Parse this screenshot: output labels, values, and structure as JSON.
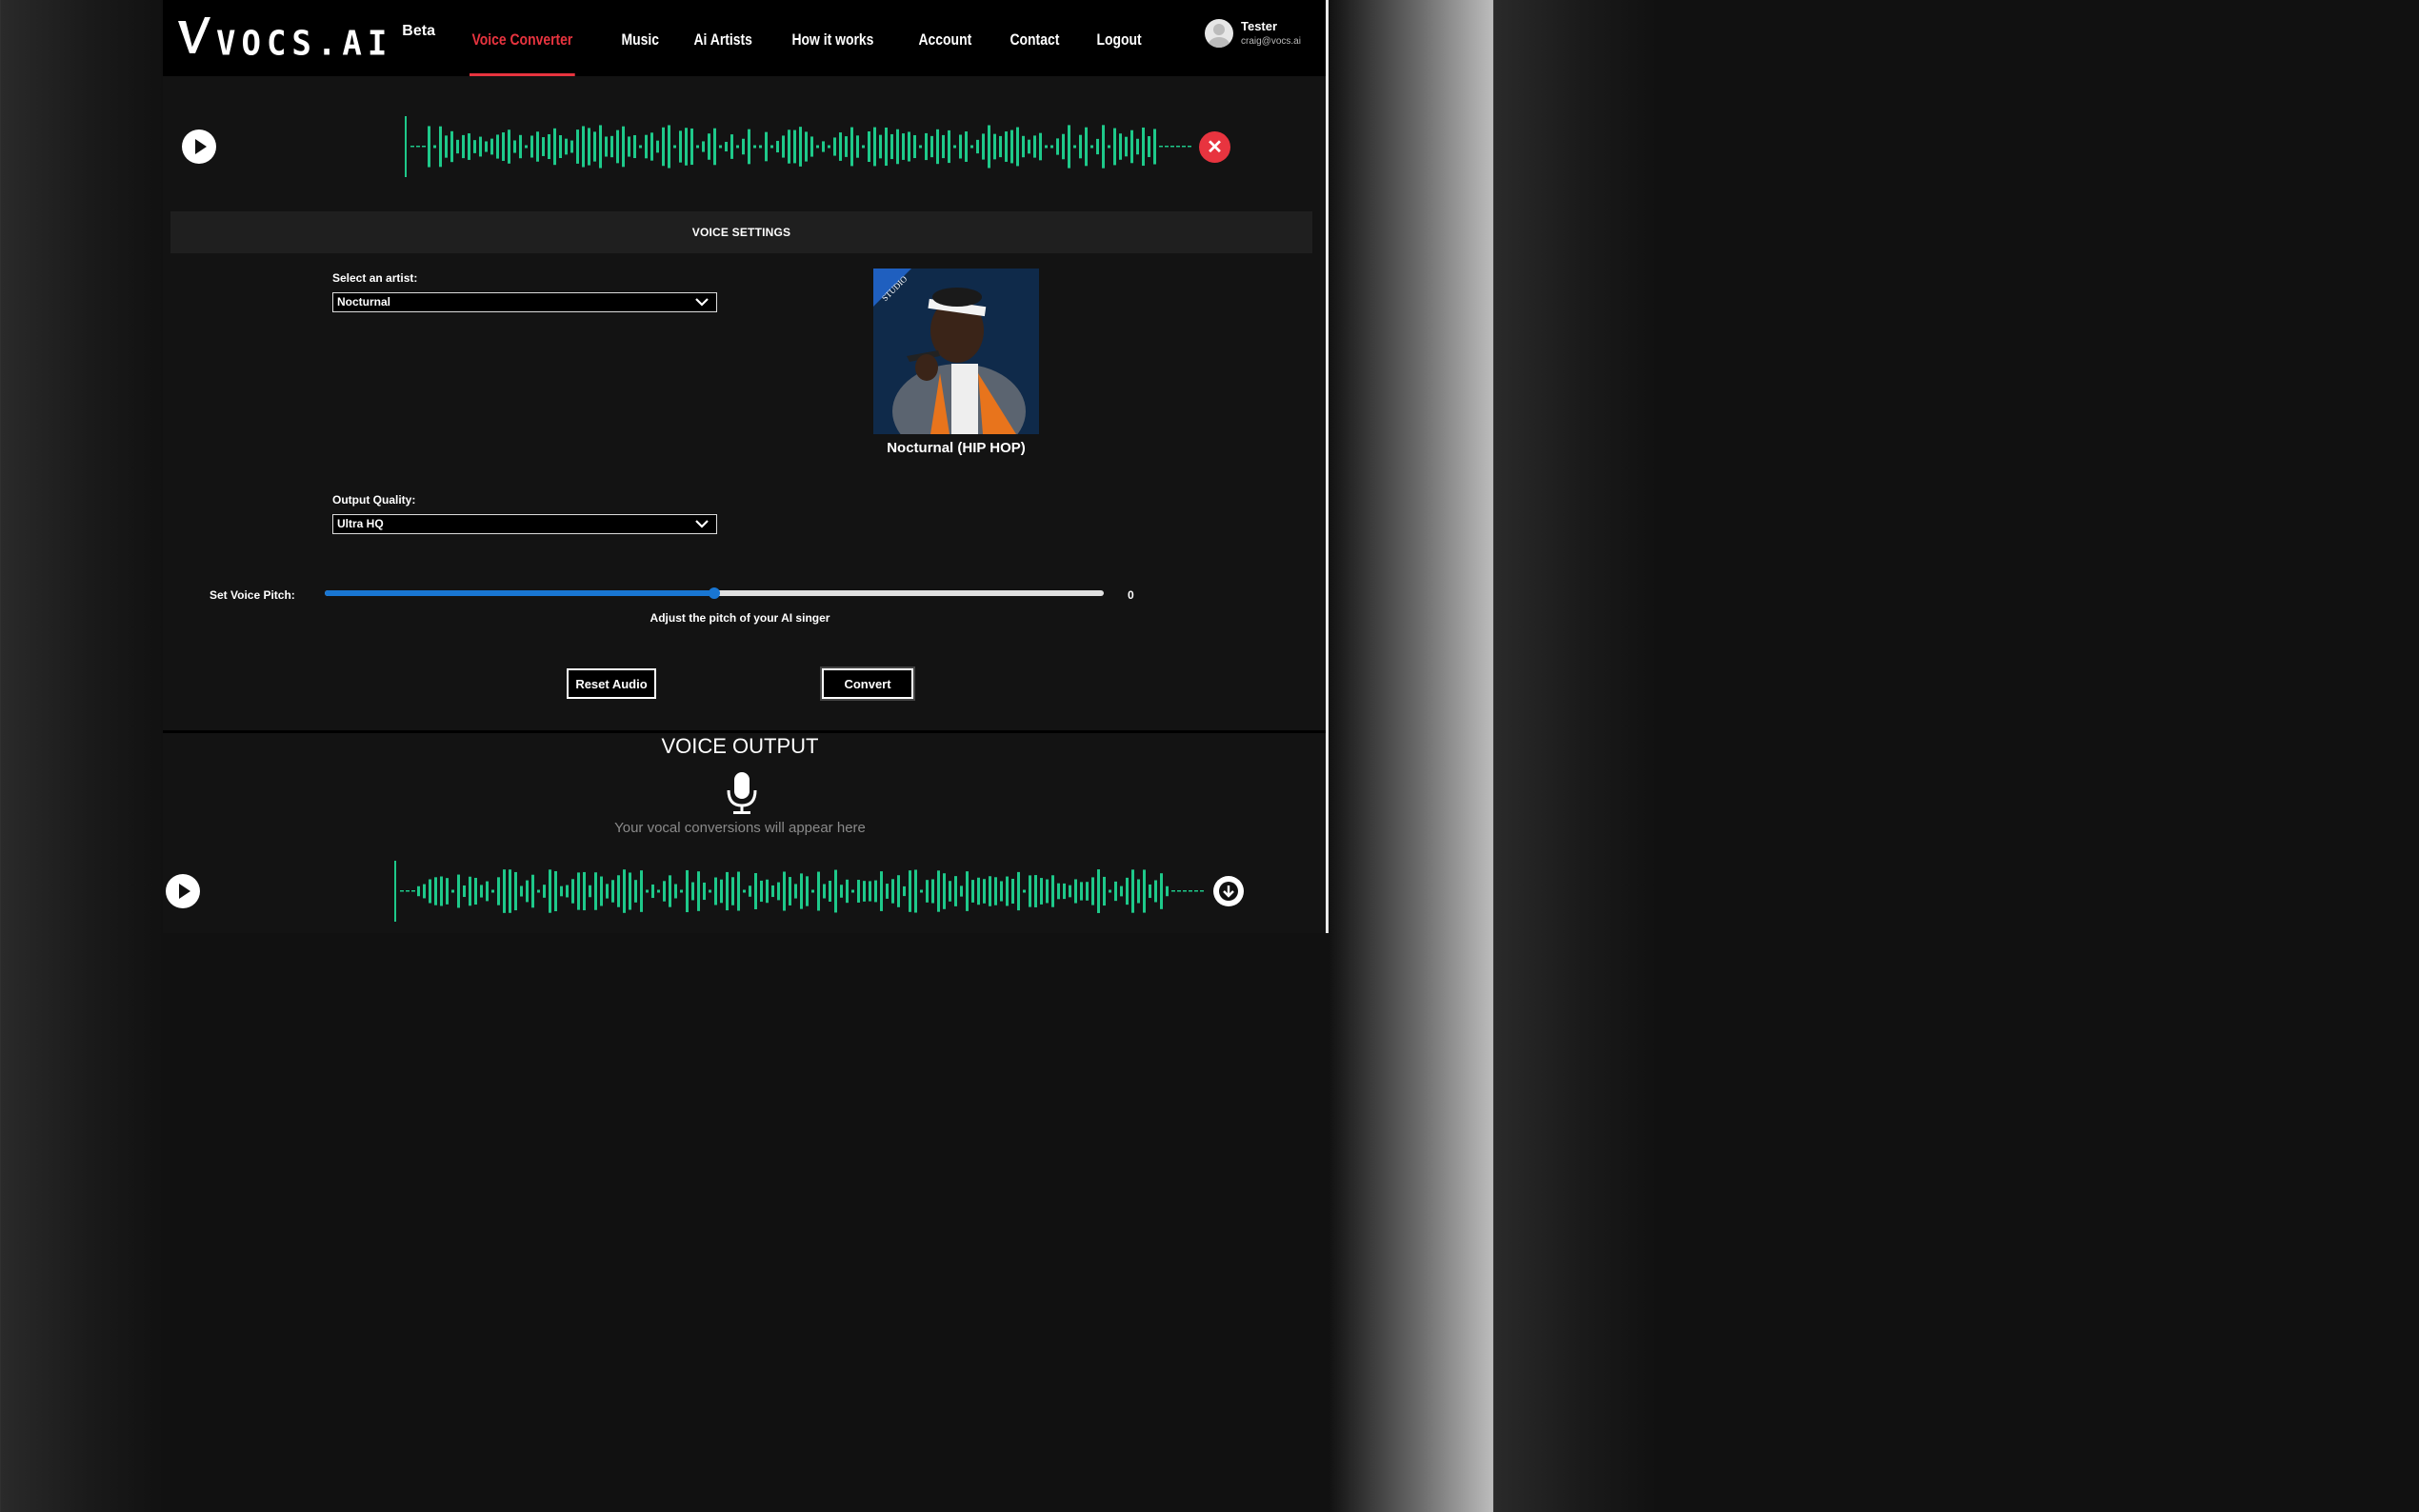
{
  "brand": {
    "name": "VOCS.AI",
    "badge": "Beta"
  },
  "nav": {
    "items": [
      {
        "label": "Voice Converter",
        "active": true
      },
      {
        "label": "Music",
        "active": false
      },
      {
        "label": "Ai Artists",
        "active": false
      },
      {
        "label": "How it works",
        "active": false
      },
      {
        "label": "Account",
        "active": false
      },
      {
        "label": "Contact",
        "active": false
      },
      {
        "label": "Logout",
        "active": false
      }
    ]
  },
  "user": {
    "name": "Tester",
    "email": "craig@vocs.ai"
  },
  "input_player": {
    "play_icon": "play-icon",
    "remove_icon": "close-icon"
  },
  "settings": {
    "header": "VOICE SETTINGS",
    "artist_label": "Select an artist:",
    "artist_value": "Nocturnal",
    "artist_caption": "Nocturnal (HIP HOP)",
    "artist_badge": "STUDIO",
    "quality_label": "Output Quality:",
    "quality_value": "Ultra HQ",
    "pitch_label": "Set Voice Pitch:",
    "pitch_value": "0",
    "pitch_fraction": 0.5,
    "pitch_hint": "Adjust the pitch of your AI singer",
    "reset_label": "Reset Audio",
    "convert_label": "Convert"
  },
  "output": {
    "title": "VOICE OUTPUT",
    "hint": "Your vocal conversions will appear here",
    "download_icon": "download-icon"
  },
  "colors": {
    "accent": "#e8343f",
    "wave": "#1ec98a",
    "slider": "#1976d2"
  }
}
